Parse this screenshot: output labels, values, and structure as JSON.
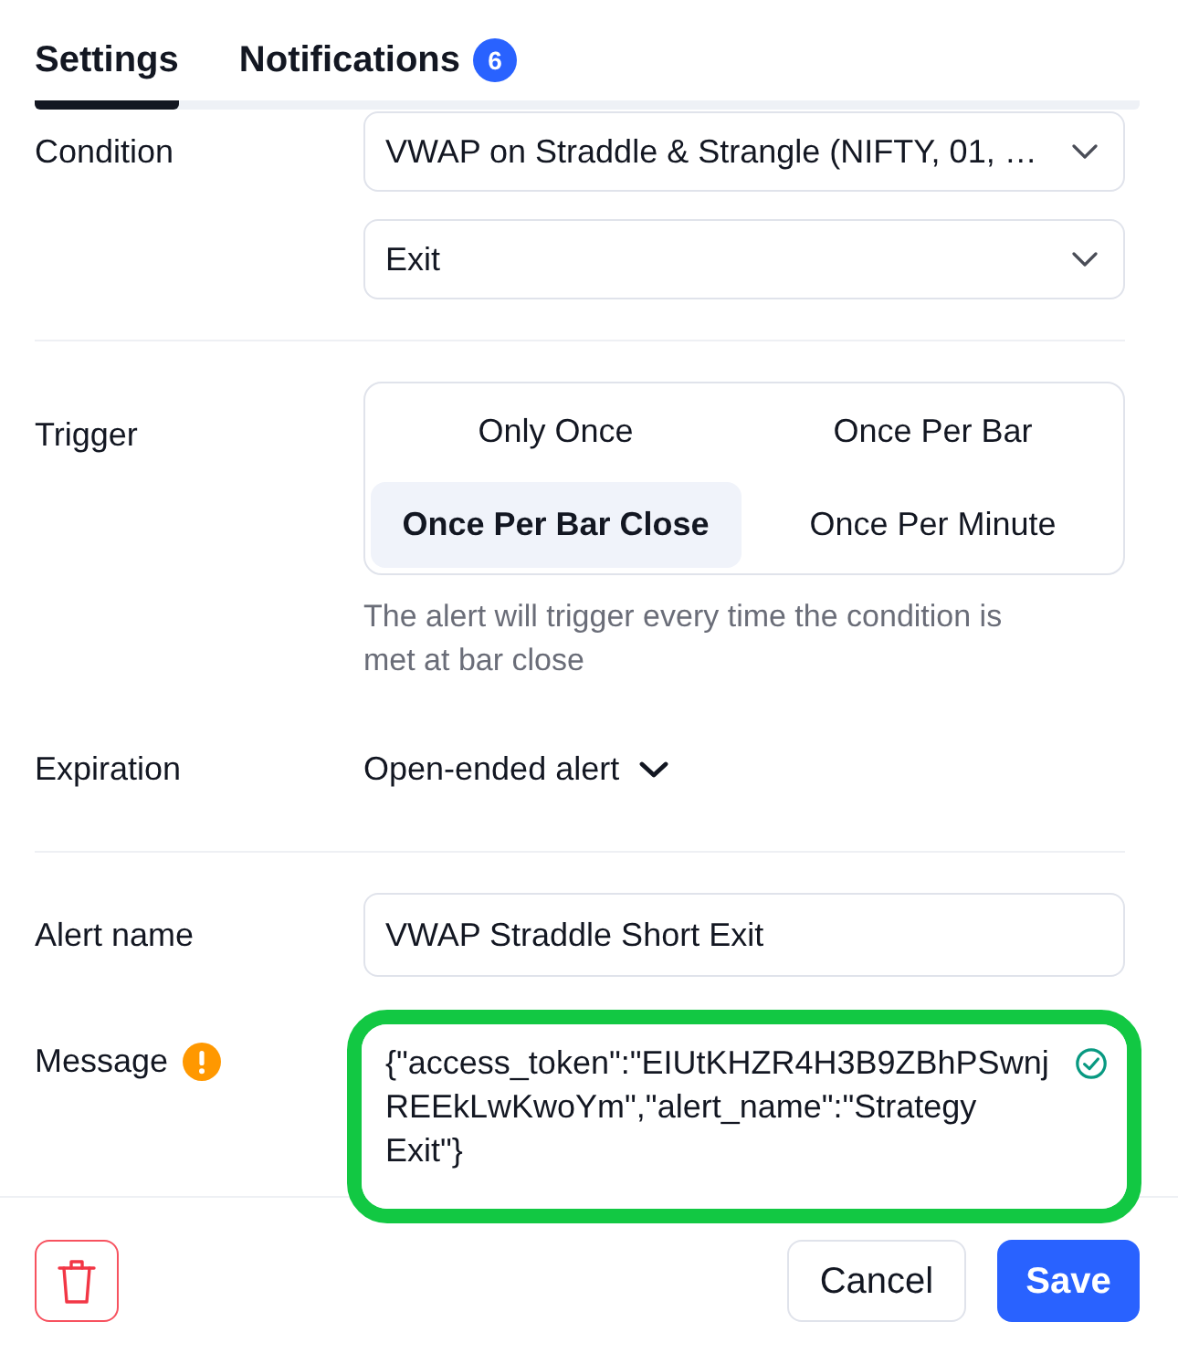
{
  "tabs": [
    {
      "label": "Settings",
      "selected": true
    },
    {
      "label": "Notifications",
      "selected": false,
      "badge": "6"
    }
  ],
  "condition": {
    "label": "Condition",
    "dropdowns": [
      "VWAP on Straddle & Strangle (NIFTY, 01, …",
      "Exit"
    ]
  },
  "trigger": {
    "label": "Trigger",
    "options": [
      {
        "label": "Only Once",
        "selected": false
      },
      {
        "label": "Once Per Bar",
        "selected": false
      },
      {
        "label": "Once Per Bar Close",
        "selected": true
      },
      {
        "label": "Once Per Minute",
        "selected": false
      }
    ],
    "hint": "The alert will trigger every time the condition is met at bar close"
  },
  "expiration": {
    "label": "Expiration",
    "value": "Open-ended alert"
  },
  "alert_name": {
    "label": "Alert name",
    "value": "VWAP Straddle Short Exit"
  },
  "message": {
    "label": "Message",
    "warning": true,
    "value": "{\"access_token\":\"EIUtKHZR4H3B9ZBhPSwnjREEkLwKwoYm\",\"alert_name\":\"Strategy Exit\"}",
    "valid": true,
    "highlighted": true
  },
  "footer": {
    "buttons": [
      {
        "kind": "delete"
      },
      {
        "kind": "secondary",
        "label": "Cancel"
      },
      {
        "kind": "primary",
        "label": "Save"
      }
    ]
  }
}
